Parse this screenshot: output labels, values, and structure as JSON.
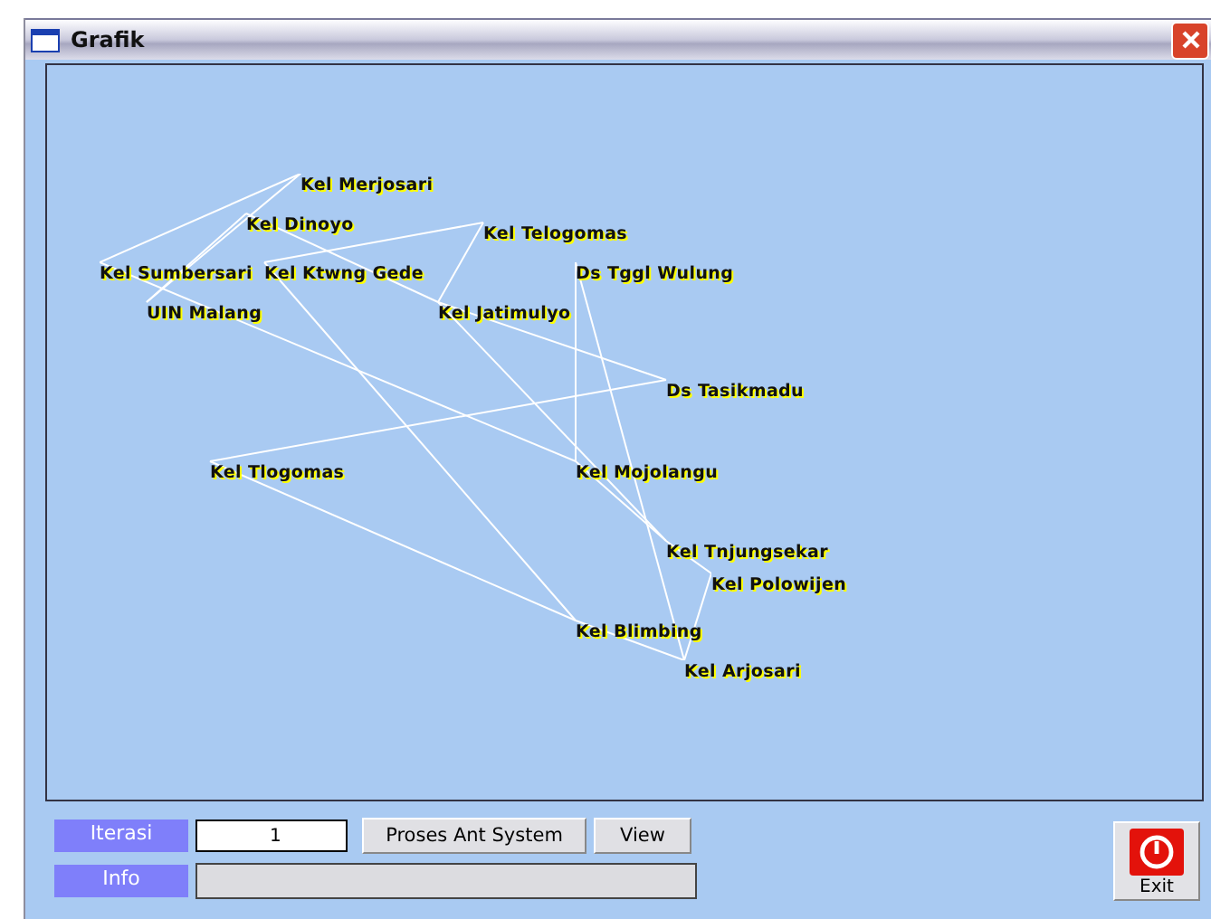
{
  "window": {
    "title": "Grafik"
  },
  "graph": {
    "nodes": [
      {
        "label": "Kel Merjosari"
      },
      {
        "label": "Kel Dinoyo"
      },
      {
        "label": "Kel Telogomas"
      },
      {
        "label": "Kel Sumbersari"
      },
      {
        "label": "Kel Ktwng Gede"
      },
      {
        "label": "Ds Tggl Wulung"
      },
      {
        "label": "UIN Malang"
      },
      {
        "label": "Kel Jatimulyo"
      },
      {
        "label": "Ds Tasikmadu"
      },
      {
        "label": "Kel Tlogomas"
      },
      {
        "label": "Kel Mojolangu"
      },
      {
        "label": "Kel Tnjungsekar"
      },
      {
        "label": "Kel Polowijen"
      },
      {
        "label": "Kel Blimbing"
      },
      {
        "label": "Kel Arjosari"
      }
    ]
  },
  "iterasi": {
    "label": "Iterasi",
    "value": "1"
  },
  "buttons": [
    {
      "label": "Proses Ant System"
    },
    {
      "label": "View"
    }
  ],
  "info": {
    "label": "Info"
  },
  "exit": {
    "label": "Exit"
  }
}
